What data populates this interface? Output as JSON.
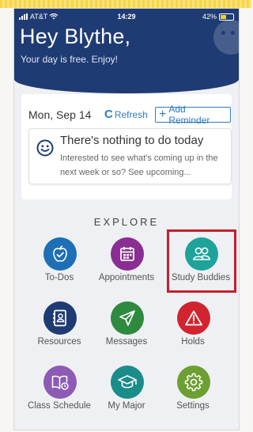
{
  "status": {
    "carrier": "AT&T",
    "time": "14:29",
    "battery": "42%"
  },
  "header": {
    "greeting": "Hey Blythe,",
    "subtitle": "Your day is free. Enjoy!"
  },
  "card": {
    "date": "Mon, Sep 14",
    "refresh_label": "Refresh",
    "add_reminder_label": "Add Reminder",
    "empty_title": "There's nothing to do today",
    "empty_desc": "Interested to see what's coming up in the next week or so? See upcoming..."
  },
  "explore": {
    "title": "EXPLORE",
    "tiles": [
      {
        "label": "To-Dos",
        "icon": "apple-check-icon",
        "color": "#1e6fb5"
      },
      {
        "label": "Appointments",
        "icon": "calendar-icon",
        "color": "#8a2e93"
      },
      {
        "label": "Study Buddies",
        "icon": "people-icon",
        "color": "#1ea39a"
      },
      {
        "label": "Resources",
        "icon": "address-book-icon",
        "color": "#1f3b73"
      },
      {
        "label": "Messages",
        "icon": "paper-plane-icon",
        "color": "#2d8a3e"
      },
      {
        "label": "Holds",
        "icon": "warning-icon",
        "color": "#d1242f"
      },
      {
        "label": "Class Schedule",
        "icon": "book-icon",
        "color": "#8d5bb5"
      },
      {
        "label": "My Major",
        "icon": "graduation-cap-icon",
        "color": "#1a8c8a"
      },
      {
        "label": "Settings",
        "icon": "gear-icon",
        "color": "#6ca032"
      }
    ]
  },
  "colors": {
    "header": "#1f3b73",
    "accent": "#2f7bbf",
    "highlight_box": "#c4202c"
  }
}
